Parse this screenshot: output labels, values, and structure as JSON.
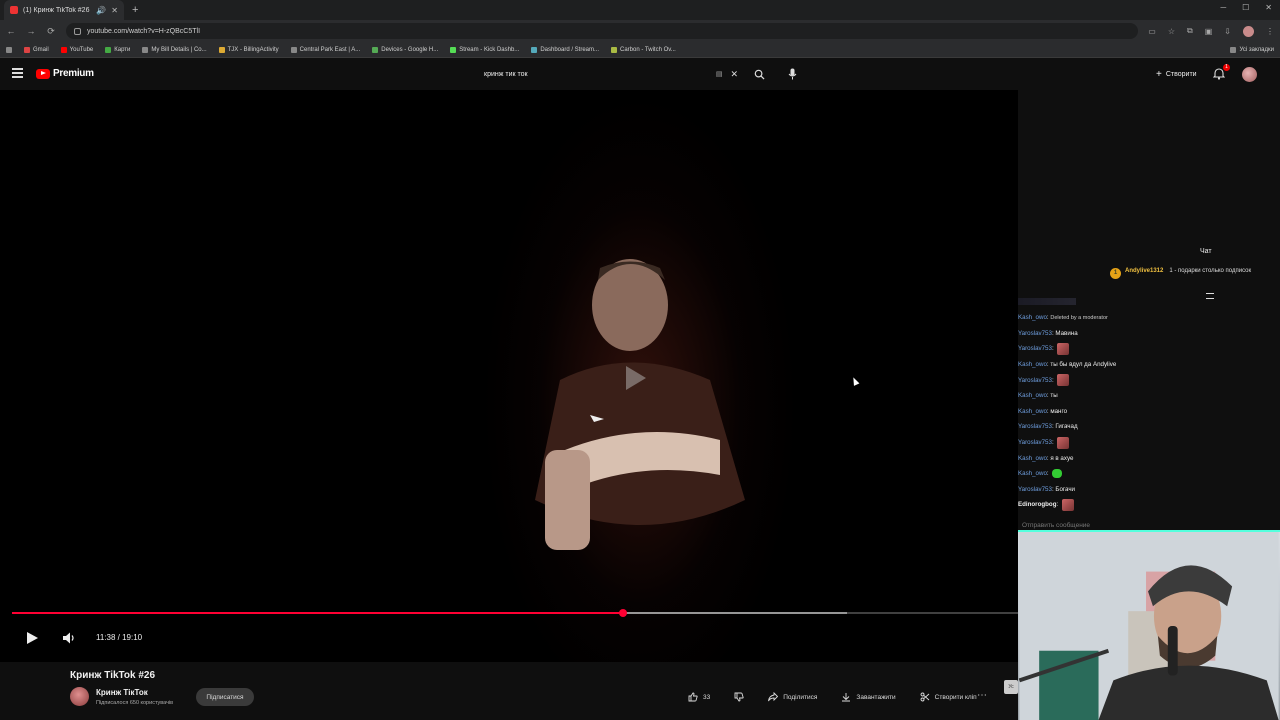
{
  "browser": {
    "tab_title": "(1) Кринж TikTok #26 - You...",
    "url": "youtube.com/watch?v=H-zQBcC5TlI",
    "bookmarks": [
      {
        "label": "Gmail"
      },
      {
        "label": "YouTube"
      },
      {
        "label": "Карти"
      },
      {
        "label": "My Bill Details | Co..."
      },
      {
        "label": "TJX - BillingActivity"
      },
      {
        "label": "Central Park East | A..."
      },
      {
        "label": "Devices - Google H..."
      },
      {
        "label": "Stream - Kick Dashb..."
      },
      {
        "label": "Dashboard / Stream..."
      },
      {
        "label": "Carbon - Twitch Ov..."
      }
    ],
    "all_bookmarks": "Усі закладки"
  },
  "youtube": {
    "logo_text": "Premium",
    "search_value": "кринж тик ток",
    "create_label": "Створити",
    "notification_count": "1"
  },
  "player": {
    "time": "11:38 / 19:10",
    "progress": 0.6069,
    "buffered": 0.83
  },
  "chat": {
    "title": "Чат",
    "pinned_user": "Andylive1312",
    "pinned_coin": "1",
    "pinned_text": "1 - подарки столько подписок",
    "messages": [
      {
        "user": "Kash_owo",
        "text": "Deleted by a moderator",
        "mod": true,
        "emote": null
      },
      {
        "user": "Yaroslav753",
        "text": "Мавина",
        "emote": null
      },
      {
        "user": "Yaroslav753",
        "text": "",
        "emote": "face"
      },
      {
        "user": "Kash_owo",
        "text": "ты бы вдул да Andylive",
        "emote": null
      },
      {
        "user": "Yaroslav753",
        "text": "",
        "emote": "face"
      },
      {
        "user": "Kash_owo",
        "text": "ты",
        "emote": null
      },
      {
        "user": "Kash_owo",
        "text": "манго",
        "emote": null
      },
      {
        "user": "Yaroslav753",
        "text": "Гигачад",
        "emote": null
      },
      {
        "user": "Yaroslav753",
        "text": "",
        "emote": "face"
      },
      {
        "user": "Kash_owo",
        "text": "я в ахуе",
        "emote": null
      },
      {
        "user": "Kash_owo",
        "text": "",
        "emote": "green"
      },
      {
        "user": "Yaroslav753",
        "text": "Богачи",
        "emote": null
      },
      {
        "user": "Edinorogbog",
        "text": "",
        "emote": "face"
      }
    ],
    "input_placeholder": "Отправить сообщение"
  },
  "video": {
    "title": "Кринж TikTok #26",
    "channel": "Кринж ТікТок",
    "subscribers": "Підписалося 650 користувачів",
    "subscribe_label": "Підписатися",
    "likes": "33",
    "share_label": "Поділитися",
    "download_label": "Завантажити",
    "clip_label": "Створити кліп",
    "corner_tag": "Ус"
  },
  "colors": {
    "accent": "#ff0033",
    "chat_user": "#6f9fe0",
    "pinned_user": "#f0c040"
  }
}
